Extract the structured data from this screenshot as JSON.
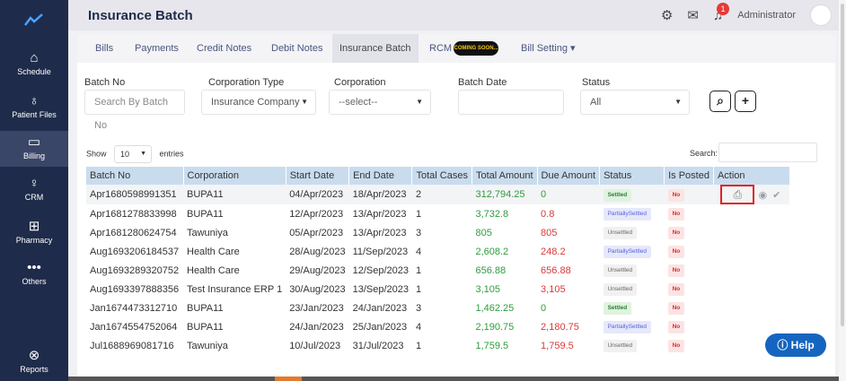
{
  "sidebar": {
    "logo_icon": "trend-line-icon",
    "items": [
      {
        "label": "Schedule",
        "icon": "home-icon"
      },
      {
        "label": "Patient Files",
        "icon": "person-icon"
      },
      {
        "label": "Billing",
        "icon": "billing-icon"
      },
      {
        "label": "CRM",
        "icon": "crm-icon"
      },
      {
        "label": "Pharmacy",
        "icon": "pharmacy-icon"
      },
      {
        "label": "Others",
        "icon": "more-icon"
      },
      {
        "label": "Reports",
        "icon": "reports-icon"
      }
    ]
  },
  "header": {
    "title": "Insurance Batch",
    "notification_count": "1",
    "user": "Administrator"
  },
  "tabs": [
    {
      "label": "Bills"
    },
    {
      "label": "Payments"
    },
    {
      "label": "Credit Notes"
    },
    {
      "label": "Debit Notes"
    },
    {
      "label": "Insurance Batch"
    },
    {
      "label": "RCM"
    },
    {
      "label": "Bill Setting ▾"
    }
  ],
  "coming_soon": "COMING SOON...",
  "filters": {
    "batch_no_label": "Batch No",
    "batch_no_placeholder": "Search By Batch No",
    "corp_type_label": "Corporation Type",
    "corp_type_value": "Insurance Company",
    "corp_label": "Corporation",
    "corp_value": "--select--",
    "batch_date_label": "Batch Date",
    "status_label": "Status",
    "status_value": "All"
  },
  "table_controls": {
    "show": "Show",
    "entries_value": "10",
    "entries": "entries",
    "search": "Search:"
  },
  "columns": [
    "Batch No",
    "Corporation",
    "Start Date",
    "End Date",
    "Total Cases",
    "Total Amount",
    "Due Amount",
    "Status",
    "Is Posted",
    "Action"
  ],
  "rows": [
    {
      "batch": "Apr1680598991351",
      "corp": "BUPA11",
      "start": "04/Apr/2023",
      "end": "18/Apr/2023",
      "cases": "2",
      "total": "312,794.25",
      "due": "0",
      "status": "Settled",
      "posted": "No",
      "actions": true
    },
    {
      "batch": "Apr1681278833998",
      "corp": "BUPA11",
      "start": "12/Apr/2023",
      "end": "13/Apr/2023",
      "cases": "1",
      "total": "3,732.8",
      "due": "0.8",
      "status": "PartiallySettled",
      "posted": "No"
    },
    {
      "batch": "Apr1681280624754",
      "corp": "Tawuniya",
      "start": "05/Apr/2023",
      "end": "13/Apr/2023",
      "cases": "3",
      "total": "805",
      "due": "805",
      "status": "Unsettled",
      "posted": "No"
    },
    {
      "batch": "Aug1693206184537",
      "corp": "Health Care",
      "start": "28/Aug/2023",
      "end": "11/Sep/2023",
      "cases": "4",
      "total": "2,608.2",
      "due": "248.2",
      "status": "PartiallySettled",
      "posted": "No"
    },
    {
      "batch": "Aug1693289320752",
      "corp": "Health Care",
      "start": "29/Aug/2023",
      "end": "12/Sep/2023",
      "cases": "1",
      "total": "656.88",
      "due": "656.88",
      "status": "Unsettled",
      "posted": "No"
    },
    {
      "batch": "Aug1693397888356",
      "corp": "Test Insurance ERP 1",
      "start": "30/Aug/2023",
      "end": "13/Sep/2023",
      "cases": "1",
      "total": "3,105",
      "due": "3,105",
      "status": "Unsettled",
      "posted": "No"
    },
    {
      "batch": "Jan1674473312710",
      "corp": "BUPA11",
      "start": "23/Jan/2023",
      "end": "24/Jan/2023",
      "cases": "3",
      "total": "1,462.25",
      "due": "0",
      "status": "Settled",
      "posted": "No"
    },
    {
      "batch": "Jan1674554752064",
      "corp": "BUPA11",
      "start": "24/Jan/2023",
      "end": "25/Jan/2023",
      "cases": "4",
      "total": "2,190.75",
      "due": "2,180.75",
      "status": "PartiallySettled",
      "posted": "No"
    },
    {
      "batch": "Jul1688969081716",
      "corp": "Tawuniya",
      "start": "10/Jul/2023",
      "end": "31/Jul/2023",
      "cases": "1",
      "total": "1,759.5",
      "due": "1,759.5",
      "status": "Unsettled",
      "posted": "No"
    }
  ],
  "help_label": "Help",
  "colors": {
    "sidebar": "#1f2b4a",
    "header_row": "#c9dcee",
    "green": "#2e9c3e",
    "red": "#d93939",
    "help": "#1565c0"
  }
}
